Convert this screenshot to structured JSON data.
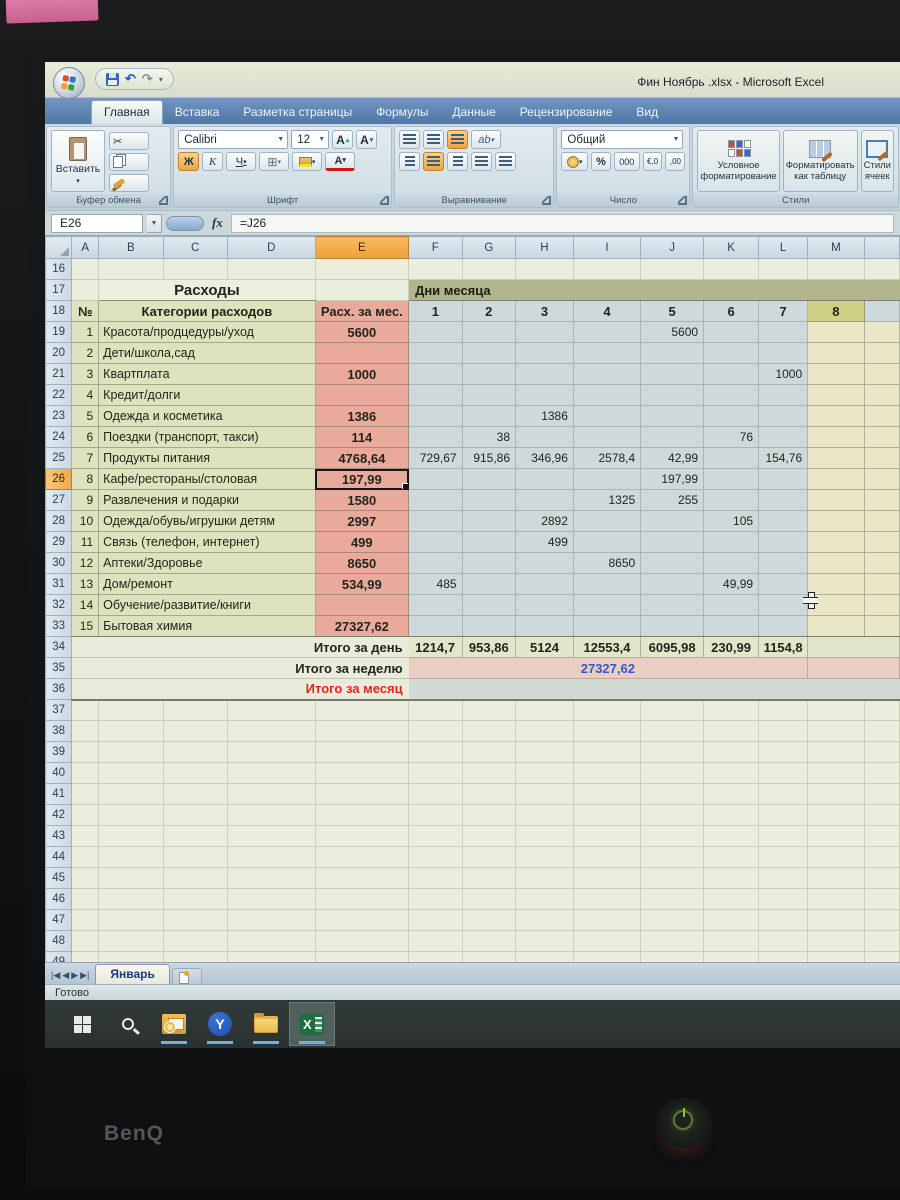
{
  "titlebar": {
    "title": "Фин Ноябрь .xlsx - Microsoft Excel"
  },
  "ribbon_tabs": [
    {
      "label": "Главная",
      "active": true
    },
    {
      "label": "Вставка",
      "active": false
    },
    {
      "label": "Разметка страницы",
      "active": false
    },
    {
      "label": "Формулы",
      "active": false
    },
    {
      "label": "Данные",
      "active": false
    },
    {
      "label": "Рецензирование",
      "active": false
    },
    {
      "label": "Вид",
      "active": false
    }
  ],
  "ribbon": {
    "clipboard": {
      "label": "Буфер обмена",
      "paste": "Вставить"
    },
    "font": {
      "label": "Шрифт",
      "family": "Calibri",
      "size": "12",
      "bold": "Ж",
      "italic": "К",
      "underline": "Ч",
      "grow": "А",
      "shrink": "А",
      "color_letter": "А"
    },
    "align": {
      "label": "Выравнивание"
    },
    "number": {
      "label": "Число",
      "format": "Общий",
      "percent": "%",
      "thousands": "000"
    },
    "styles": {
      "label": "Стили",
      "conditional": "Условное форматирование",
      "as_table": "Форматировать как таблицу",
      "cell_styles": "Стили ячеек"
    }
  },
  "formula_bar": {
    "name_box": "E26",
    "fx": "fx",
    "formula": "=J26"
  },
  "grid": {
    "columns": [
      "A",
      "B",
      "C",
      "D",
      "E",
      "F",
      "G",
      "H",
      "I",
      "J",
      "K",
      "L",
      "M"
    ],
    "selected_column": "E",
    "selected_row": 26,
    "first_row": 16,
    "last_row": 49
  },
  "sheet": {
    "expenses_title": "Расходы",
    "days_title": "Дни месяца",
    "num_header": "№",
    "cat_header": "Категории расходов",
    "month_header": "Расх. за мес.",
    "day_headers": [
      "1",
      "2",
      "3",
      "4",
      "5",
      "6",
      "7",
      "8"
    ],
    "categories": [
      {
        "n": "1",
        "name": "Красота/продцедуры/уход",
        "month": "5600",
        "days": [
          "",
          "",
          "",
          "",
          "5600",
          "",
          "",
          ""
        ]
      },
      {
        "n": "2",
        "name": "Дети/школа,сад",
        "month": "",
        "days": [
          "",
          "",
          "",
          "",
          "",
          "",
          "",
          ""
        ]
      },
      {
        "n": "3",
        "name": "Квартплата",
        "month": "1000",
        "days": [
          "",
          "",
          "",
          "",
          "",
          "",
          "1000",
          ""
        ]
      },
      {
        "n": "4",
        "name": "Кредит/долги",
        "month": "",
        "days": [
          "",
          "",
          "",
          "",
          "",
          "",
          "",
          ""
        ]
      },
      {
        "n": "5",
        "name": "Одежда и косметика",
        "month": "1386",
        "days": [
          "",
          "",
          "1386",
          "",
          "",
          "",
          "",
          ""
        ]
      },
      {
        "n": "6",
        "name": "Поездки (транспорт, такси)",
        "month": "114",
        "days": [
          "",
          "38",
          "",
          "",
          "",
          "76",
          "",
          ""
        ]
      },
      {
        "n": "7",
        "name": "Продукты питания",
        "month": "4768,64",
        "days": [
          "729,67",
          "915,86",
          "346,96",
          "2578,4",
          "42,99",
          "",
          "154,76",
          ""
        ]
      },
      {
        "n": "8",
        "name": "Кафе/рестораны/столовая",
        "month": "197,99",
        "days": [
          "",
          "",
          "",
          "",
          "197,99",
          "",
          "",
          ""
        ]
      },
      {
        "n": "9",
        "name": "Развлечения и подарки",
        "month": "1580",
        "days": [
          "",
          "",
          "",
          "1325",
          "255",
          "",
          "",
          ""
        ]
      },
      {
        "n": "10",
        "name": "Одежда/обувь/игрушки детям",
        "month": "2997",
        "days": [
          "",
          "",
          "2892",
          "",
          "",
          "105",
          "",
          ""
        ]
      },
      {
        "n": "11",
        "name": "Связь (телефон, интернет)",
        "month": "499",
        "days": [
          "",
          "",
          "499",
          "",
          "",
          "",
          "",
          ""
        ]
      },
      {
        "n": "12",
        "name": "Аптеки/Здоровье",
        "month": "8650",
        "days": [
          "",
          "",
          "",
          "8650",
          "",
          "",
          "",
          ""
        ]
      },
      {
        "n": "13",
        "name": "Дом/ремонт",
        "month": "534,99",
        "days": [
          "485",
          "",
          "",
          "",
          "",
          "49,99",
          "",
          ""
        ]
      },
      {
        "n": "14",
        "name": "Обучение/развитие/книги",
        "month": "",
        "days": [
          "",
          "",
          "",
          "",
          "",
          "",
          "",
          ""
        ]
      },
      {
        "n": "15",
        "name": "Бытовая химия",
        "month": "27327,62",
        "days": [
          "",
          "",
          "",
          "",
          "",
          "",
          "",
          ""
        ]
      }
    ],
    "totals": {
      "day_label": "Итого за день",
      "day_values": [
        "1214,7",
        "953,86",
        "5124",
        "12553,4",
        "6095,98",
        "230,99",
        "1154,8"
      ],
      "week_label": "Итого за неделю",
      "week_value": "27327,62",
      "month_label": "Итого за месяц"
    }
  },
  "sheet_tabs": {
    "active": "Январь"
  },
  "status_bar": {
    "ready": "Готово"
  },
  "taskbar": {
    "icons": [
      "start",
      "search",
      "outlook",
      "yandex-browser",
      "file-explorer",
      "excel"
    ],
    "active_icon": "excel"
  },
  "monitor": {
    "brand": "BenQ"
  },
  "colors": {
    "selection_orange": "#f0a040",
    "category_olive": "#dee3bd",
    "month_salmon": "#e9aa9c",
    "day_blue": "#cdd9da",
    "week_band_pink": "#eccdc5",
    "week_value_blue": "#2f5cc4",
    "month_label_red": "#e1251b",
    "taskbar_accent": "#6cb2e8"
  }
}
